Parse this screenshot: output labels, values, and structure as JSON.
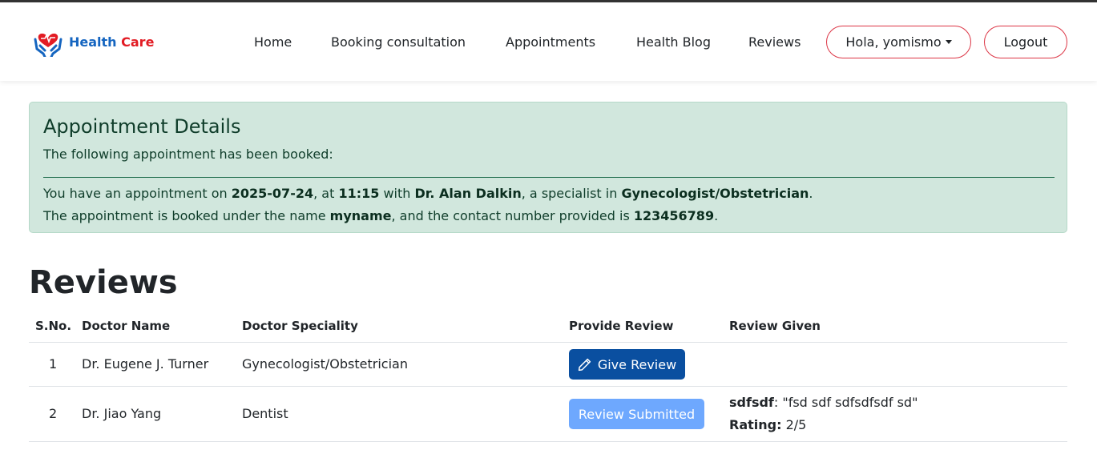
{
  "brand": {
    "name_part1": "Health",
    "name_part2": "Care"
  },
  "nav": {
    "items": [
      "Home",
      "Booking consultation",
      "Appointments",
      "Health Blog",
      "Reviews"
    ],
    "user_greeting": "Hola, yomismo",
    "logout_label": "Logout"
  },
  "alert": {
    "title": "Appointment Details",
    "subtitle": "The following appointment has been booked:",
    "line1": {
      "t1": "You have an appointment on ",
      "date": "2025-07-24",
      "t2": ", at ",
      "time": "11:15",
      "t3": " with ",
      "doctor": "Dr. Alan Dalkin",
      "t4": ", a specialist in ",
      "speciality": "Gynecologist/Obstetrician",
      "t5": "."
    },
    "line2": {
      "t1": "The appointment is booked under the name ",
      "name": "myname",
      "t2": ", and the contact number provided is ",
      "phone": "123456789",
      "t3": "."
    }
  },
  "reviews": {
    "title": "Reviews",
    "headers": [
      "S.No.",
      "Doctor Name",
      "Doctor Speciality",
      "Provide Review",
      "Review Given"
    ],
    "rows": [
      {
        "sno": "1",
        "doctor": "Dr. Eugene J. Turner",
        "speciality": "Gynecologist/Obstetrician",
        "action": "Give Review",
        "review_author": "",
        "review_quote": "",
        "rating_label": "",
        "rating_value": ""
      },
      {
        "sno": "2",
        "doctor": "Dr. Jiao Yang",
        "speciality": "Dentist",
        "action": "Review Submitted",
        "review_author": "sdfsdf",
        "review_quote": ": \"fsd sdf sdfsdfsdf sd\"",
        "rating_label": "Rating:",
        "rating_value": " 2/5"
      }
    ]
  },
  "colors": {
    "brand_blue": "#1565c0",
    "brand_red": "#e21b23",
    "alert_bg": "#d1e7dd",
    "primary": "#0a4fa0",
    "primary_disabled": "#6ea8fe",
    "pill_border": "#dc3545"
  },
  "icons": {
    "logo": "heart-hands-icon",
    "edit": "pencil-icon",
    "dropdown": "caret-down-icon"
  }
}
